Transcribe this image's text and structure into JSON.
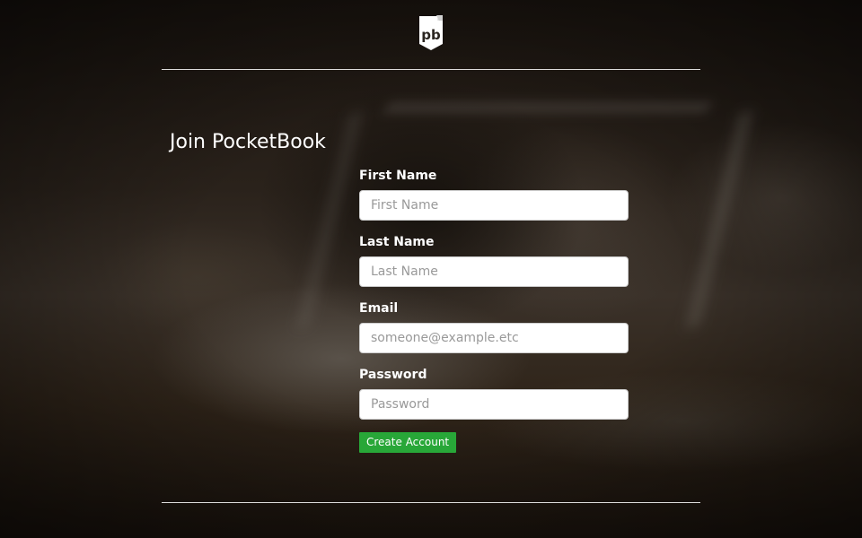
{
  "brand": {
    "logo_text": "pb",
    "logo_icon": "pocketbook-logo-icon"
  },
  "page": {
    "title": "Join PocketBook"
  },
  "form": {
    "fields": [
      {
        "label": "First Name",
        "placeholder": "First Name",
        "value": ""
      },
      {
        "label": "Last Name",
        "placeholder": "Last Name",
        "value": ""
      },
      {
        "label": "Email",
        "placeholder": "someone@example.etc",
        "value": ""
      },
      {
        "label": "Password",
        "placeholder": "Password",
        "value": ""
      }
    ],
    "submit_label": "Create Account"
  },
  "colors": {
    "accent_button": "#28a738",
    "text": "#ffffff",
    "background": "#1e1812"
  }
}
